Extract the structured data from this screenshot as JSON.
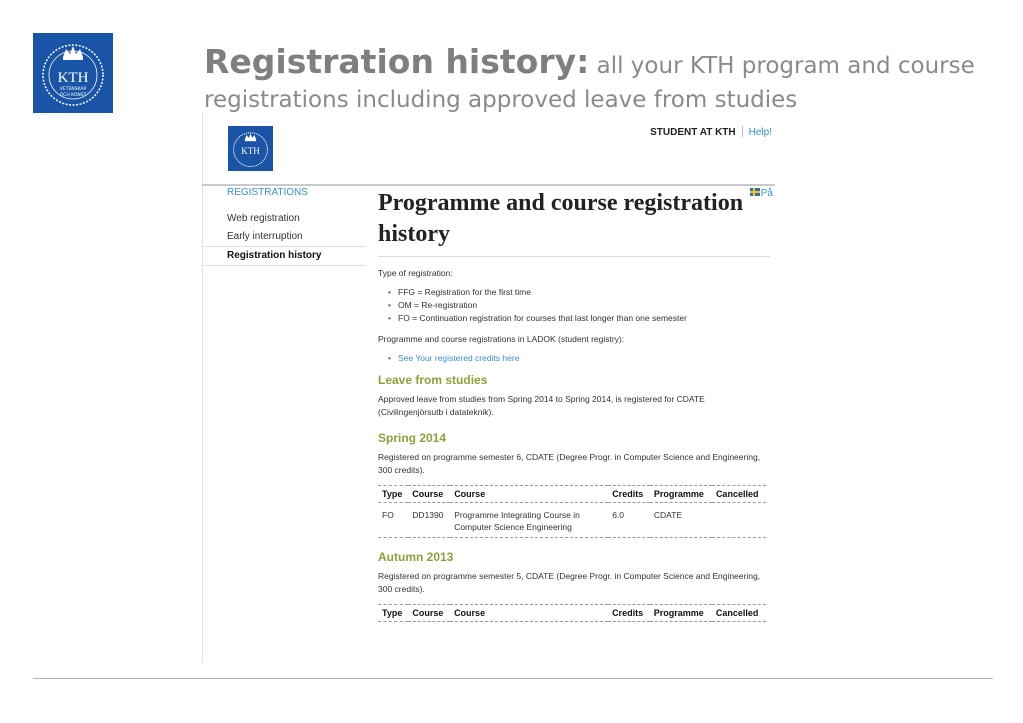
{
  "slide": {
    "title_strong": "Registration history:",
    "title_rest": " all your KTH program and course registrations including approved leave from studies"
  },
  "logo": {
    "text": "KTH",
    "sub1": "VETENSKAP",
    "sub2": "OCH KONST"
  },
  "header": {
    "student_link": "STUDENT AT KTH",
    "help_link": "Help!",
    "language_link": "På"
  },
  "sidebar": {
    "heading": "REGISTRATIONS",
    "items": [
      {
        "label": "Web registration"
      },
      {
        "label": "Early interruption"
      },
      {
        "label": "Registration history"
      }
    ]
  },
  "content": {
    "page_title": "Programme and course registration history",
    "type_label": "Type of registration:",
    "types": [
      "FFG = Registration for the first time",
      "OM = Re-registration",
      "FO = Continuation registration for courses that last longer than one semester"
    ],
    "ladok_text": "Programme and course registrations in LADOK (student registry):",
    "ladok_link": "See Your registered credits here",
    "leave_heading": "Leave from studies",
    "leave_text": "Approved leave from studies from Spring 2014 to Spring 2014, is registered for CDATE (Civilingenjörsutb i datateknik).",
    "columns": [
      "Type",
      "Course",
      "Course",
      "Credits",
      "Programme",
      "Cancelled"
    ],
    "semesters": [
      {
        "heading": "Spring 2014",
        "text": "Registered on programme semester 6, CDATE (Degree Progr. in Computer Science and Engineering, 300 credits).",
        "rows": [
          {
            "type": "FO",
            "code": "DD1390",
            "name": "Programme Integrating Course in Computer Science Engineering",
            "credits": "6.0",
            "programme": "CDATE",
            "cancelled": ""
          }
        ]
      },
      {
        "heading": "Autumn 2013",
        "text": "Registered on programme semester 5, CDATE (Degree Progr. in Computer Science and Engineering, 300 credits)."
      }
    ]
  }
}
